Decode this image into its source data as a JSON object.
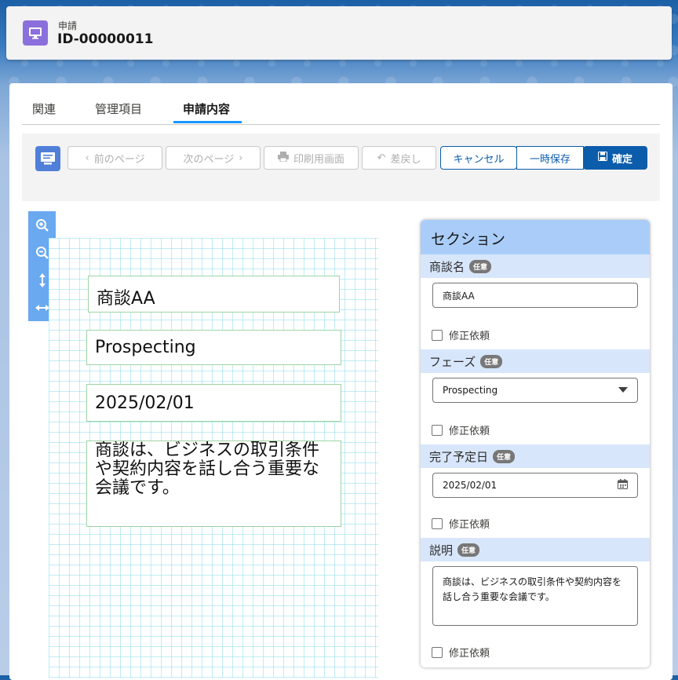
{
  "header": {
    "object_type": "申請",
    "record_id": "ID-00000011"
  },
  "tabs": [
    {
      "label": "関連"
    },
    {
      "label": "管理項目"
    },
    {
      "label": "申請内容",
      "active": true
    }
  ],
  "toolbar": {
    "prev_label": "前のページ",
    "next_label": "次のページ",
    "print_label": "印刷用画面",
    "return_label": "差戻し",
    "cancel_label": "キャンセル",
    "temp_save_label": "一時保存",
    "confirm_label": "確定"
  },
  "canvas_fields": {
    "opportunity_name": "商談AA",
    "phase": "Prospecting",
    "close_date": "2025/02/01",
    "description": "商談は、ビジネスの取引条件や契約内容を話し合う重要な会議です。"
  },
  "section": {
    "title": "セクション",
    "optional_badge": "任意",
    "correction_label": "修正依頼",
    "fields": {
      "opportunity_name": {
        "label": "商談名",
        "value": "商談AA"
      },
      "phase": {
        "label": "フェーズ",
        "value": "Prospecting"
      },
      "close_date": {
        "label": "完了予定日",
        "value": "2025/02/01"
      },
      "description": {
        "label": "説明",
        "value": "商談は、ビジネスの取引条件や契約内容を話し合う重要な会議です。"
      }
    }
  },
  "colors": {
    "brand": "#0b5cab",
    "section_header": "#a9cdf8",
    "label_row": "#d8e6fb",
    "object_icon": "#8b6fdc"
  }
}
